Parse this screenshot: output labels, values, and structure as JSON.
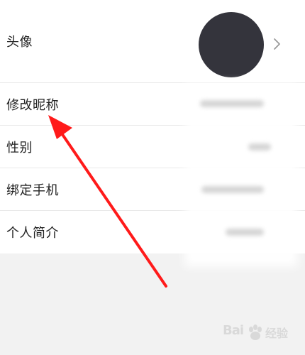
{
  "settings": {
    "rows": [
      {
        "label": "头像"
      },
      {
        "label": "修改昵称"
      },
      {
        "label": "性别"
      },
      {
        "label": "绑定手机"
      },
      {
        "label": "个人简介"
      }
    ]
  },
  "colors": {
    "avatar": "#34343c",
    "annotation_arrow": "#ff1a1a",
    "background": "#f2f2f2",
    "row_background": "#ffffff"
  },
  "icons": {
    "chevron": "chevron-right-icon",
    "paw": "baidu-paw-icon"
  },
  "watermark": {
    "brand": "Bai",
    "suffix": "经验"
  }
}
